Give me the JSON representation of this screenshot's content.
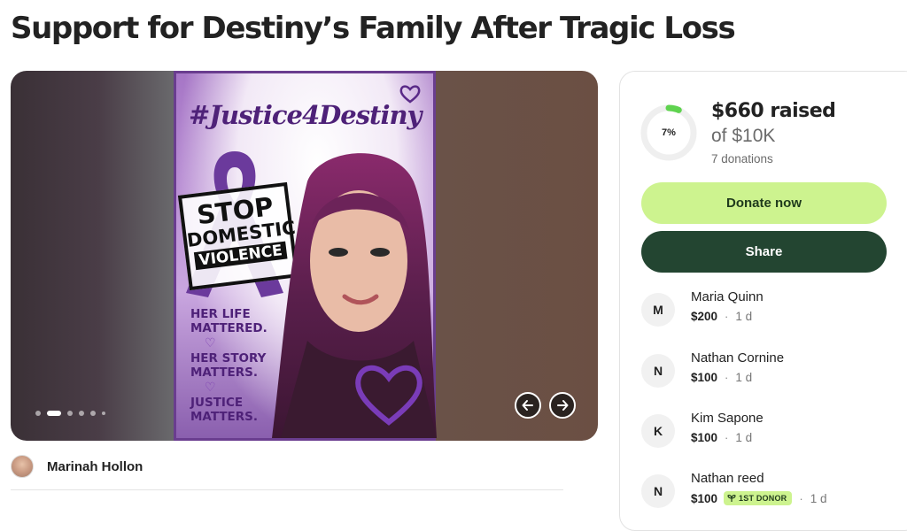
{
  "page": {
    "title": "Support for Destiny’s Family After Tragic Loss"
  },
  "media": {
    "poster": {
      "hashtag": "#Justice4Destiny",
      "stamp_line1": "STOP",
      "stamp_line2": "DOMESTIC",
      "stamp_line3": "VIOLENCE",
      "slogan_line1": "HER LIFE MATTERED.",
      "slogan_line2": "HER STORY MATTERS.",
      "slogan_line3": "JUSTICE MATTERS."
    },
    "slide_count": 6,
    "active_slide": 2,
    "prev_icon": "arrow-left-icon",
    "next_icon": "arrow-right-icon"
  },
  "organizer": {
    "name": "Marinah Hollon"
  },
  "donation_card": {
    "progress_label": "7%",
    "progress_fraction": 0.066,
    "raised": "$660 raised",
    "goal": "of $10K",
    "donation_count": "7 donations",
    "donate_label": "Donate now",
    "share_label": "Share",
    "donors": [
      {
        "initial": "M",
        "name": "Maria Quinn",
        "amount": "$200",
        "time": "1 d"
      },
      {
        "initial": "N",
        "name": "Nathan Cornine",
        "amount": "$100",
        "time": "1 d"
      },
      {
        "initial": "K",
        "name": "Kim Sapone",
        "amount": "$100",
        "time": "1 d"
      },
      {
        "initial": "N",
        "name": "Nathan reed",
        "amount": "$100",
        "badge": "1ST DONOR",
        "time": "1 d"
      }
    ]
  },
  "colors": {
    "accent_green": "#cdf38f",
    "dark_green": "#234531",
    "progress_green": "#5fd34f",
    "poster_purple": "#4e2178"
  }
}
